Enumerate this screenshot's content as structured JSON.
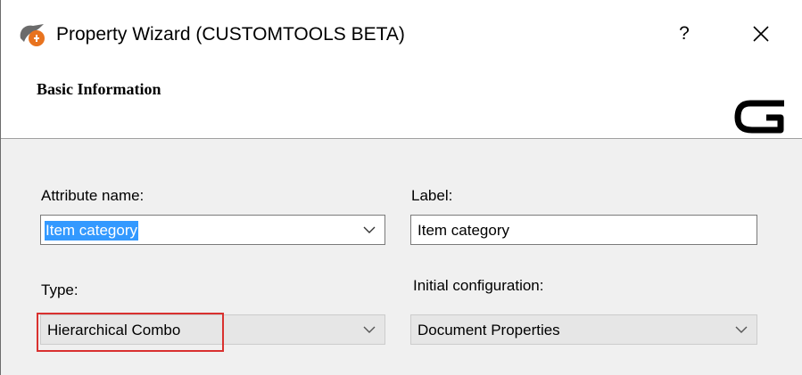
{
  "window": {
    "title": "Property Wizard (CUSTOMTOOLS BETA)",
    "help_label": "?",
    "close_icon": "close-icon",
    "app_icon": "customtools-app-icon"
  },
  "header": {
    "title": "Basic Information",
    "logo_icon": "customtools-logo-icon"
  },
  "form": {
    "attribute_name": {
      "label": "Attribute name:",
      "value": "Item category"
    },
    "label_field": {
      "label": "Label:",
      "value": "Item category"
    },
    "type": {
      "label": "Type:",
      "value": "Hierarchical Combo"
    },
    "initial_configuration": {
      "label": "Initial configuration:",
      "value": "Document Properties"
    }
  },
  "colors": {
    "selection": "#3399ff",
    "highlight": "#d9312f",
    "accent": "#e8731f"
  }
}
